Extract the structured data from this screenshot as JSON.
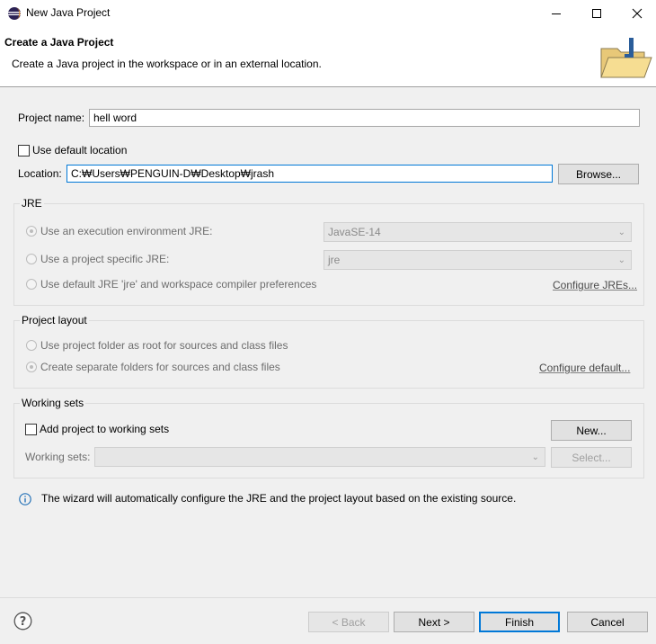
{
  "window": {
    "title": "New Java Project",
    "minimize_icon": "minimize-icon",
    "maximize_icon": "maximize-icon",
    "close_icon": "close-icon"
  },
  "header": {
    "title": "Create a Java Project",
    "description": "Create a Java project in the workspace or in an external location."
  },
  "project": {
    "name_label": "Project name:",
    "name_value": "hell word",
    "use_default_location_label": "Use default location",
    "use_default_location_checked": false,
    "location_label": "Location:",
    "location_value": "C:₩Users₩PENGUIN-D₩Desktop₩jrash",
    "browse_label": "Browse..."
  },
  "jre": {
    "group_title": "JRE",
    "options": [
      {
        "label": "Use an execution environment JRE:",
        "selected": true
      },
      {
        "label": "Use a project specific JRE:",
        "selected": false
      },
      {
        "label": "Use default JRE 'jre' and workspace compiler preferences",
        "selected": false
      }
    ],
    "execution_env_value": "JavaSE-14",
    "project_jre_value": "jre",
    "configure_link": "Configure JREs..."
  },
  "layout": {
    "group_title": "Project layout",
    "options": [
      {
        "label": "Use project folder as root for sources and class files",
        "selected": false
      },
      {
        "label": "Create separate folders for sources and class files",
        "selected": true
      }
    ],
    "configure_link": "Configure default..."
  },
  "working_sets": {
    "group_title": "Working sets",
    "add_label": "Add project to working sets",
    "add_checked": false,
    "new_label": "New...",
    "sets_label": "Working sets:",
    "sets_value": "",
    "select_label": "Select..."
  },
  "info": {
    "icon": "info-icon",
    "message": "The wizard will automatically configure the JRE and the project layout based on the existing source."
  },
  "footer": {
    "help_icon": "help-icon",
    "back_label": "< Back",
    "next_label": "Next >",
    "finish_label": "Finish",
    "cancel_label": "Cancel"
  }
}
